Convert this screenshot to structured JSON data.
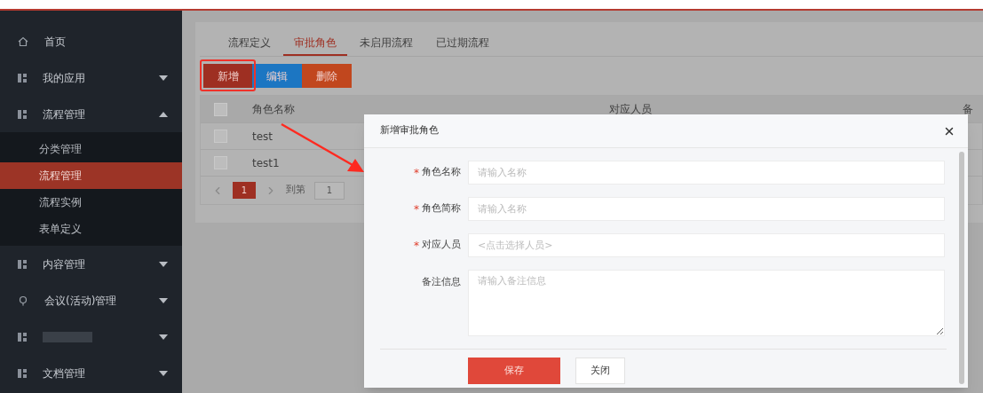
{
  "sidebar": {
    "items": [
      {
        "kind": "home",
        "label": "首页"
      },
      {
        "kind": "module",
        "label": "我的应用",
        "expanded": false
      },
      {
        "kind": "module",
        "label": "流程管理",
        "expanded": true,
        "children": [
          {
            "label": "分类管理",
            "selected": false
          },
          {
            "label": "流程管理",
            "selected": true
          },
          {
            "label": "流程实例",
            "selected": false
          },
          {
            "label": "表单定义",
            "selected": false
          }
        ]
      },
      {
        "kind": "module",
        "label": "内容管理",
        "expanded": false
      },
      {
        "kind": "pin",
        "label": "会议(活动)管理",
        "expanded": false
      },
      {
        "kind": "redacted",
        "expanded": false
      },
      {
        "kind": "module",
        "label": "文档管理",
        "expanded": false
      }
    ]
  },
  "tabs": [
    {
      "label": "流程定义",
      "selected": false
    },
    {
      "label": "审批角色",
      "selected": true
    },
    {
      "label": "未启用流程",
      "selected": false
    },
    {
      "label": "已过期流程",
      "selected": false
    }
  ],
  "toolbar": [
    {
      "label": "新增",
      "kind": "add"
    },
    {
      "label": "编辑",
      "kind": "edit"
    },
    {
      "label": "删除",
      "kind": "delete"
    }
  ],
  "table": {
    "header_checked": false,
    "columns": [
      "角色名称",
      "对应人员",
      "备"
    ],
    "rows": [
      {
        "checked": false,
        "name": "test"
      },
      {
        "checked": false,
        "name": "test1"
      }
    ]
  },
  "pagination": {
    "page": "1",
    "goto_label": "到第",
    "goto_value": "1"
  },
  "dialog": {
    "title": "新增审批角色",
    "fields": [
      {
        "kind": "input",
        "label": "角色名称",
        "required_mark": "*",
        "placeholder": "请输入名称"
      },
      {
        "kind": "input",
        "label": "角色简称",
        "required_mark": "*",
        "placeholder": "请输入名称"
      },
      {
        "kind": "input",
        "label": "对应人员",
        "required_mark": "*",
        "placeholder": "<点击选择人员>"
      },
      {
        "kind": "textarea",
        "label": "备注信息",
        "placeholder": "请输入备注信息"
      }
    ],
    "buttons": [
      {
        "label": "保存",
        "kind": "save"
      },
      {
        "label": "关闭",
        "kind": "close"
      }
    ]
  }
}
